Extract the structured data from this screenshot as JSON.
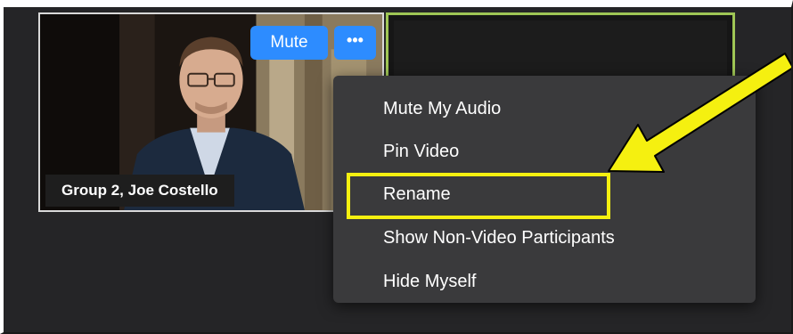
{
  "participant": {
    "name_label": "Group 2, Joe Costello"
  },
  "controls": {
    "mute_label": "Mute",
    "more_label": "•••"
  },
  "menu": {
    "items": [
      {
        "label": "Mute My Audio"
      },
      {
        "label": "Pin Video"
      },
      {
        "label": "Rename"
      },
      {
        "label": "Show Non-Video Participants"
      },
      {
        "label": "Hide Myself"
      }
    ]
  },
  "colors": {
    "button_blue": "#2d8cff",
    "highlight_yellow": "#f5f010",
    "active_speaker_green": "#9fc655",
    "menu_bg": "#3a3a3c"
  }
}
